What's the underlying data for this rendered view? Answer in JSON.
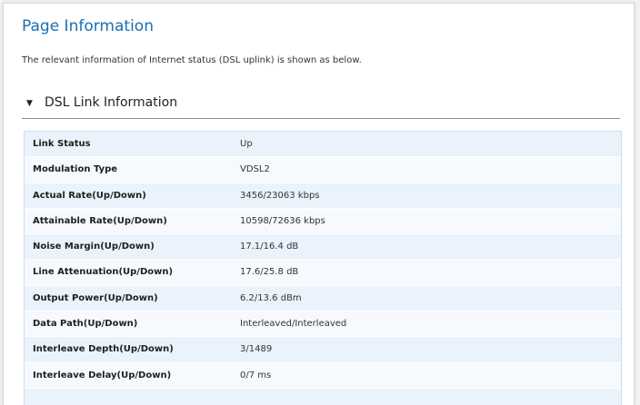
{
  "page": {
    "title": "Page Information",
    "description": "The relevant information of Internet status (DSL uplink) is shown as below."
  },
  "section": {
    "toggle_icon": "triangle-down-icon",
    "title": "DSL Link Information"
  },
  "colors": {
    "title": "#1a6fb3",
    "row_odd": "#eaf3fc",
    "row_even": "#f6f9fd"
  },
  "dsl_info": {
    "rows": [
      {
        "label": "Link Status",
        "value": "Up"
      },
      {
        "label": "Modulation Type",
        "value": "VDSL2"
      },
      {
        "label": "Actual Rate(Up/Down)",
        "value": "3456/23063 kbps"
      },
      {
        "label": "Attainable Rate(Up/Down)",
        "value": "10598/72636 kbps"
      },
      {
        "label": "Noise Margin(Up/Down)",
        "value": "17.1/16.4 dB"
      },
      {
        "label": "Line Attenuation(Up/Down)",
        "value": "17.6/25.8 dB"
      },
      {
        "label": "Output Power(Up/Down)",
        "value": "6.2/13.6 dBm"
      },
      {
        "label": "Data Path(Up/Down)",
        "value": "Interleaved/Interleaved"
      },
      {
        "label": "Interleave Depth(Up/Down)",
        "value": "3/1489"
      },
      {
        "label": "Interleave Delay(Up/Down)",
        "value": "0/7 ms"
      }
    ]
  }
}
